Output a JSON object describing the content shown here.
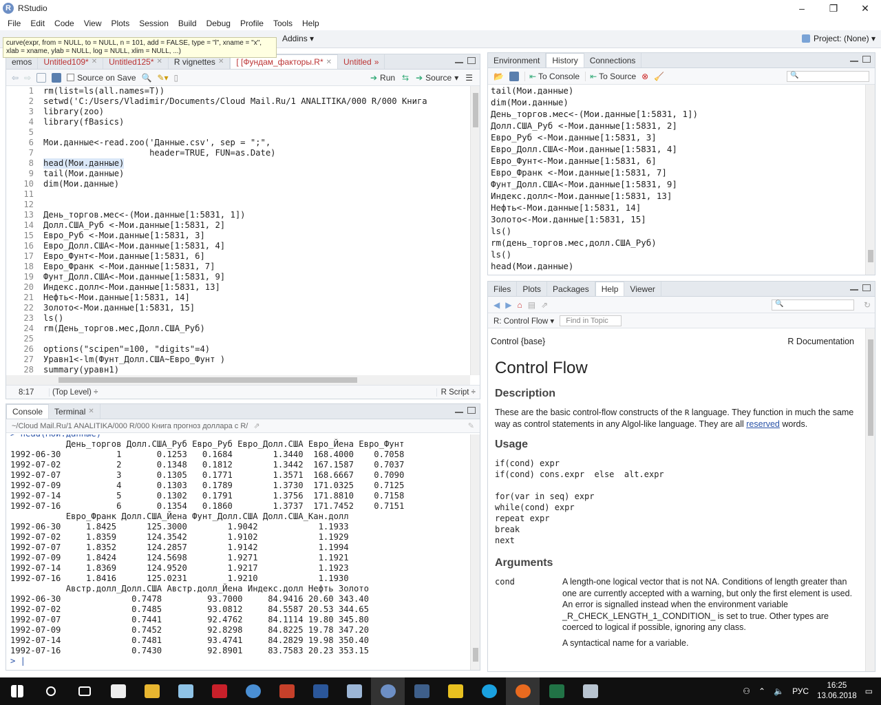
{
  "window": {
    "title": "RStudio",
    "min": "–",
    "max": "❐",
    "close": "✕"
  },
  "menu": [
    "File",
    "Edit",
    "Code",
    "View",
    "Plots",
    "Session",
    "Build",
    "Debug",
    "Profile",
    "Tools",
    "Help"
  ],
  "toolbar": {
    "addins": "Addins ▾",
    "project": "Project: (None) ▾"
  },
  "tooltip": "curve(expr, from = NULL, to = NULL, n = 101, add = FALSE, type = \"l\", xname = \"x\", xlab = xname, ylab = NULL, log = NULL, xlim = NULL, ...)",
  "editor": {
    "tabs": [
      {
        "label": "emos"
      },
      {
        "label": "Untitled109*"
      },
      {
        "label": "Untitled125*"
      },
      {
        "label": "R vignettes"
      },
      {
        "label": "[ [Фундам_факторы.R*"
      },
      {
        "label": "Untitled"
      }
    ],
    "source_on_save": "Source on Save",
    "run": "Run",
    "source": "Source",
    "lines": [
      "rm(list=ls(all.names=T))",
      "setwd('C:/Users/Vladimir/Documents/Cloud Mail.Ru/1 ANALITIKA/000 R/000 Книга",
      "library(zoo)",
      "library(fBasics)",
      "",
      "Мои.данные<-read.zoo('Данные.csv', sep = \";\",",
      "                     header=TRUE, FUN=as.Date)",
      "head(Мои.данные)",
      "tail(Мои.данные)",
      "dim(Мои.данные)",
      "",
      "",
      "День_торгов.мес<-(Мои.данные[1:5831, 1])",
      "Долл.США_Руб <-Мои.данные[1:5831, 2]",
      "Евро_Руб <-Мои.данные[1:5831, 3]",
      "Евро_Долл.США<-Мои.данные[1:5831, 4]",
      "Евро_Фунт<-Мои.данные[1:5831, 6]",
      "Евро_Франк <-Мои.данные[1:5831, 7]",
      "Фунт_Долл.США<-Мои.данные[1:5831, 9]",
      "Индекс.долл<-Мои.данные[1:5831, 13]",
      "Нефть<-Мои.данные[1:5831, 14]",
      "Золото<-Мои.данные[1:5831, 15]",
      "ls()",
      "rm(День_торгов.мес,Долл.США_Руб)",
      "",
      "options(\"scipen\"=100, \"digits\"=4)",
      "Уравн1<-lm(Фунт_Долл.США~Евро_Фунт )",
      "summary(уравн1)",
      ""
    ],
    "status": {
      "position": "8:17",
      "scope": "(Top Level) ÷",
      "type": "R Script ÷"
    }
  },
  "console": {
    "tabs": [
      {
        "label": "Console"
      },
      {
        "label": "Terminal"
      }
    ],
    "path": "~/Cloud Mail.Ru/1 ANALITIKA/000 R/000 Книга прогноз доллара с R/",
    "lines": [
      "> head(Мои.данные)",
      "           День_торгов Долл.США_Руб Евро_Руб Евро_Долл.США Евро_Йена Евро_Фунт",
      "1992-06-30           1       0.1253   0.1684        1.3440  168.4000    0.7058",
      "1992-07-02           2       0.1348   0.1812        1.3442  167.1587    0.7037",
      "1992-07-07           3       0.1305   0.1771        1.3571  168.6667    0.7090",
      "1992-07-09           4       0.1303   0.1789        1.3730  171.0325    0.7125",
      "1992-07-14           5       0.1302   0.1791        1.3756  171.8810    0.7158",
      "1992-07-16           6       0.1354   0.1860        1.3737  171.7452    0.7151",
      "           Евро_Франк Долл.США_Йена Фунт_Долл.США Долл.США_Кан.долл",
      "1992-06-30     1.8425      125.3000        1.9042            1.1933",
      "1992-07-02     1.8359      124.3542        1.9102            1.1929",
      "1992-07-07     1.8352      124.2857        1.9142            1.1994",
      "1992-07-09     1.8424      124.5698        1.9271            1.1921",
      "1992-07-14     1.8369      124.9520        1.9217            1.1923",
      "1992-07-16     1.8416      125.0231        1.9210            1.1930",
      "           Австр.долл_Долл.США Австр.долл_Йена Индекс.долл Нефть Золото",
      "1992-06-30              0.7478         93.7000     84.9416 20.60 343.40",
      "1992-07-02              0.7485         93.0812     84.5587 20.53 344.65",
      "1992-07-07              0.7441         92.4762     84.1114 19.80 345.80",
      "1992-07-09              0.7452         92.8298     84.8225 19.78 347.20",
      "1992-07-14              0.7481         93.4741     84.2829 19.98 350.40",
      "1992-07-16              0.7430         92.8901     83.7583 20.23 353.15",
      "> |"
    ]
  },
  "environment": {
    "tabs": [
      {
        "label": "Environment"
      },
      {
        "label": "History"
      },
      {
        "label": "Connections"
      }
    ],
    "to_console": "To Console",
    "to_source": "To Source",
    "history": [
      "tail(Мои.данные)",
      "dim(Мои.данные)",
      "День_торгов.мес<-(Мои.данные[1:5831, 1])",
      "Долл.США_Руб <-Мои.данные[1:5831, 2]",
      "Евро_Руб <-Мои.данные[1:5831, 3]",
      "Евро_Долл.США<-Мои.данные[1:5831, 4]",
      "Евро_Фунт<-Мои.данные[1:5831, 6]",
      "Евро_Франк <-Мои.данные[1:5831, 7]",
      "Фунт_Долл.США<-Мои.данные[1:5831, 9]",
      "Индекс.долл<-Мои.данные[1:5831, 13]",
      "Нефть<-Мои.данные[1:5831, 14]",
      "Золото<-Мои.данные[1:5831, 15]",
      "ls()",
      "rm(день_торгов.мес,долл.США_Руб)",
      "ls()",
      "head(Мои.данные)"
    ]
  },
  "help": {
    "tabs": [
      {
        "label": "Files"
      },
      {
        "label": "Plots"
      },
      {
        "label": "Packages"
      },
      {
        "label": "Help"
      },
      {
        "label": "Viewer"
      }
    ],
    "topic": "R: Control Flow ▾",
    "find_placeholder": "Find in Topic",
    "header_left": "Control {base}",
    "header_right": "R Documentation",
    "title": "Control Flow",
    "description_h": "Description",
    "description_1": "These are the basic control-flow constructs of the ",
    "description_r": "R",
    "description_2": " language. They function in much the same way as control statements in any Algol-like language. They are all ",
    "description_link": "reserved",
    "description_3": " words.",
    "usage_h": "Usage",
    "usage_1": "if(cond) expr\nif(cond) cons.expr  else  alt.expr",
    "usage_2": "for(var in seq) expr\nwhile(cond) expr\nrepeat expr\nbreak\nnext",
    "arguments_h": "Arguments",
    "arg_name": "cond",
    "arg_desc": "A length-one logical vector that is not NA. Conditions of length greater than one are currently accepted with a warning, but only the first element is used. An error is signalled instead when the environment variable _R_CHECK_LENGTH_1_CONDITION_ is set to true. Other types are coerced to logical if possible, ignoring any class.",
    "arg_cut": "A syntactical name for a variable."
  },
  "taskbar": {
    "lang": "РУС",
    "time": "16:25",
    "date": "13.06.2018"
  }
}
